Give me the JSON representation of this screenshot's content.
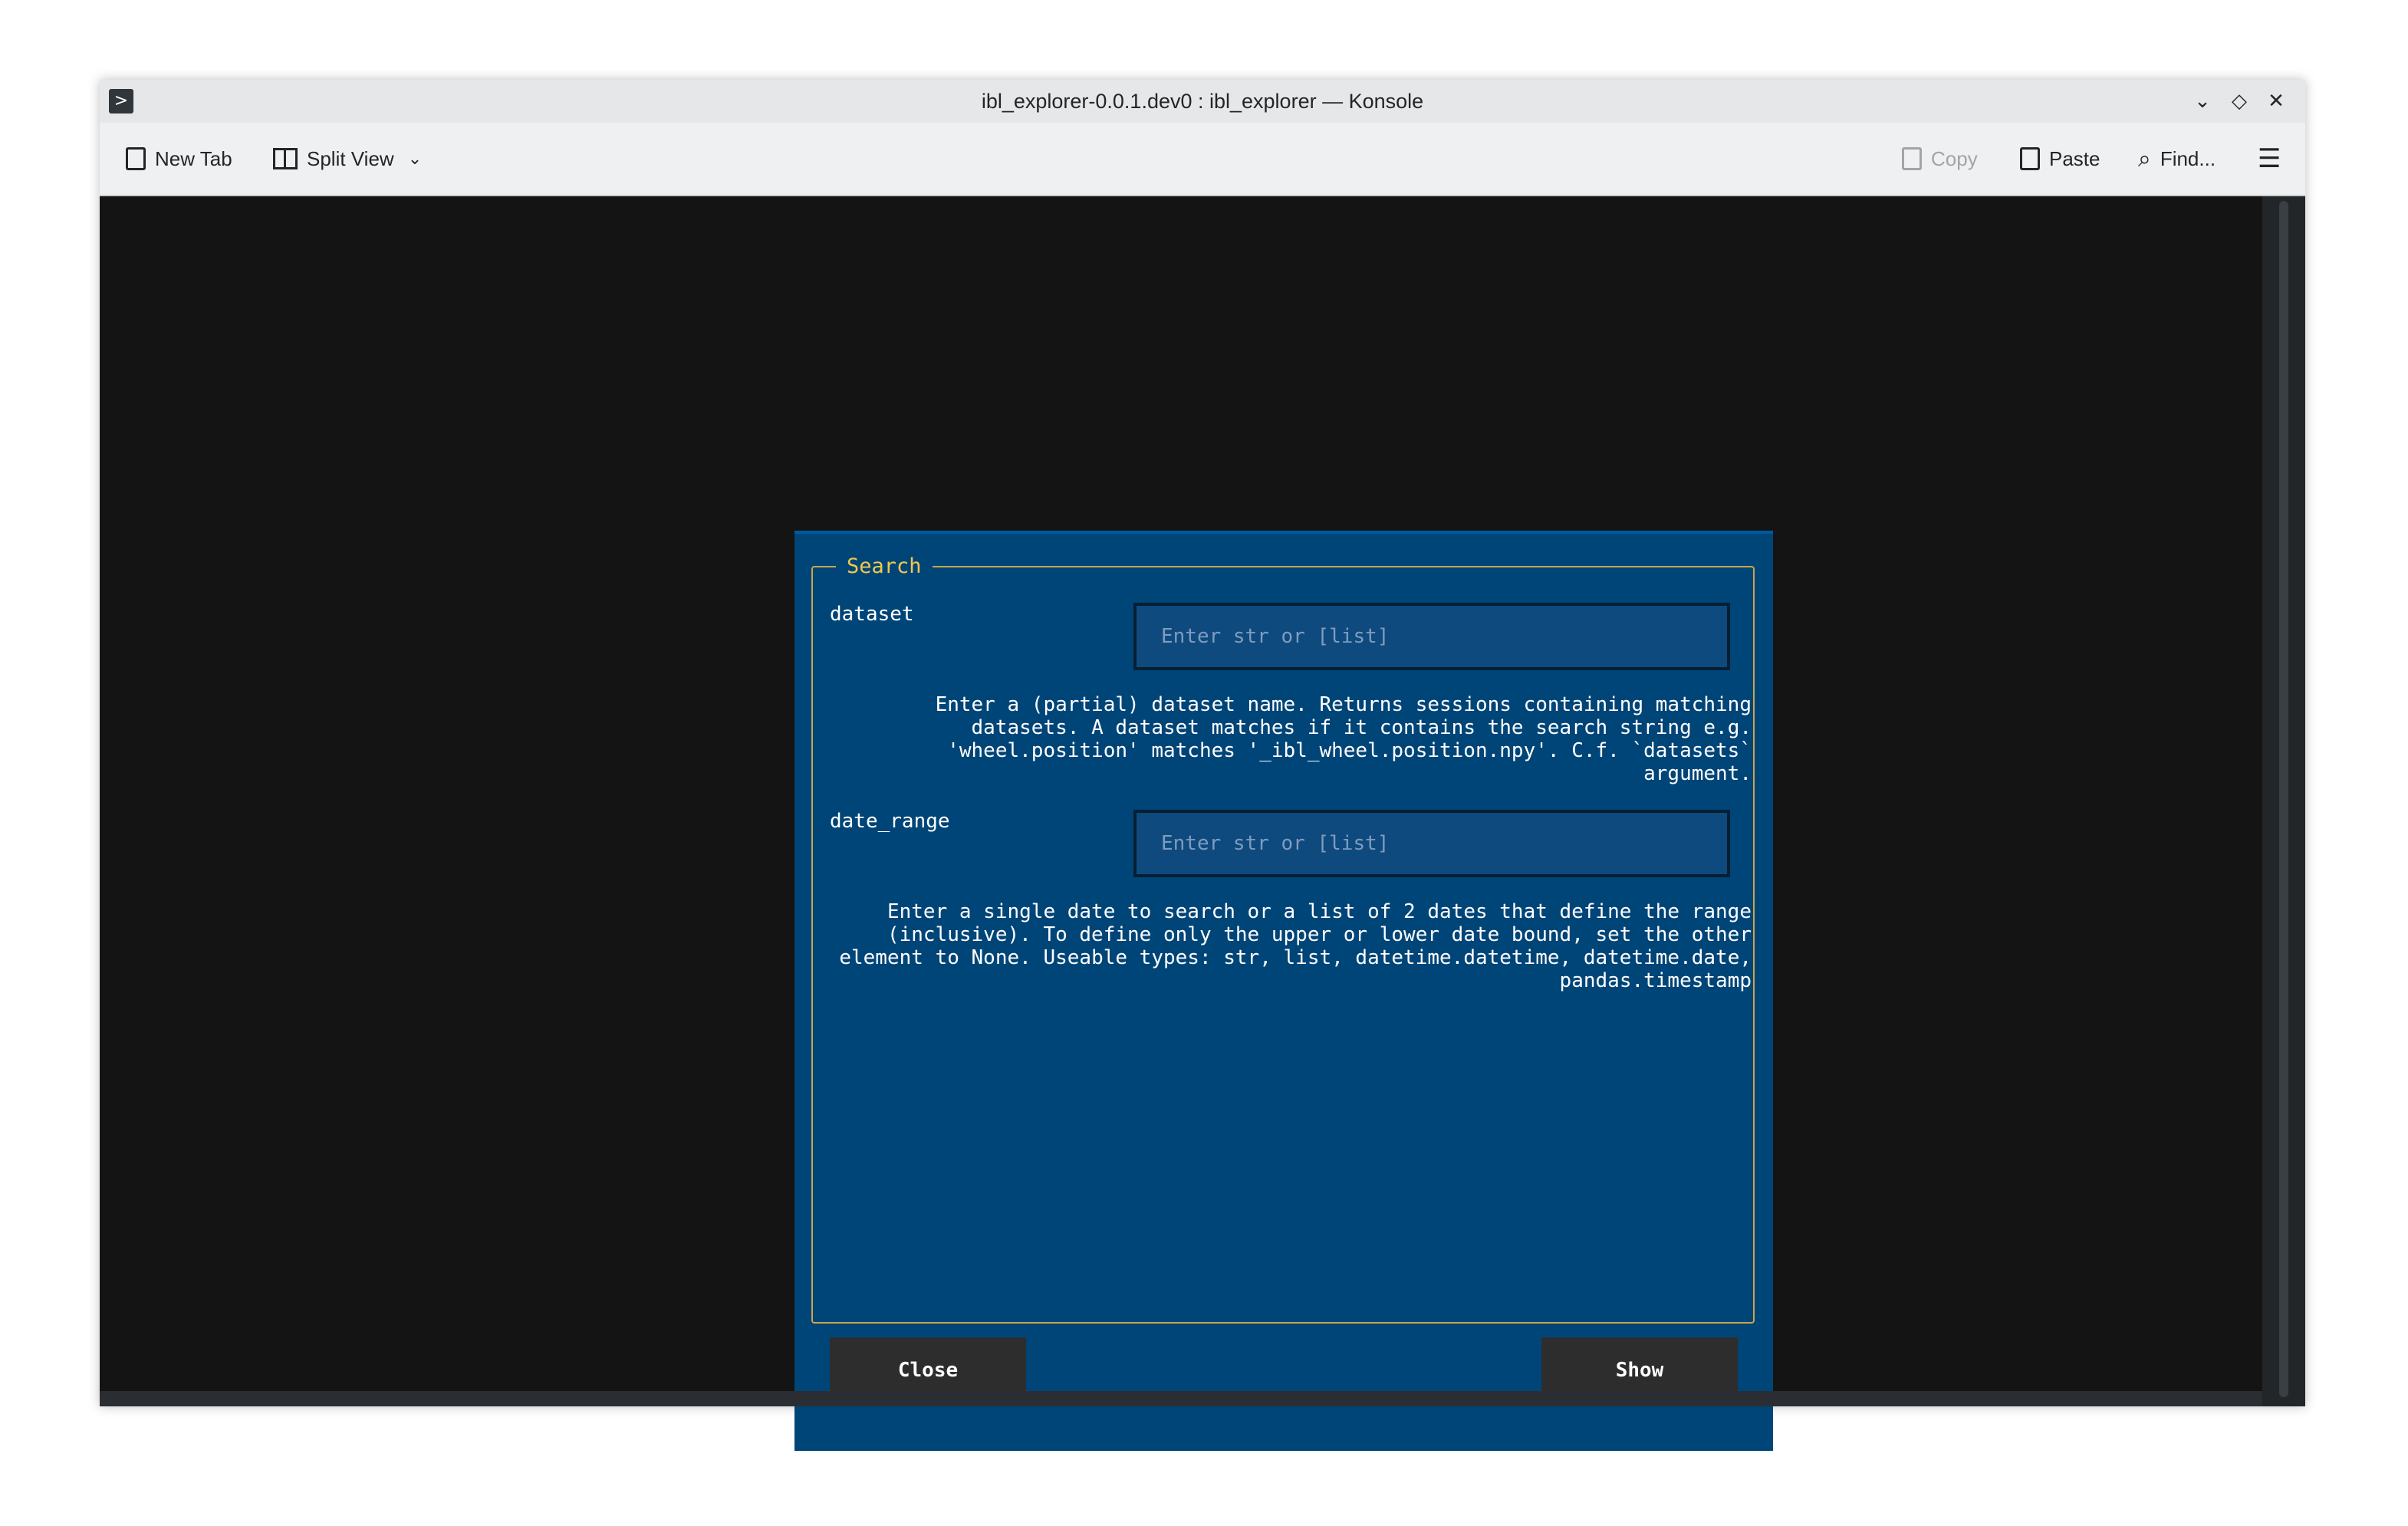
{
  "window": {
    "title": "ibl_explorer-0.0.1.dev0 : ibl_explorer — Konsole",
    "app_icon": ">",
    "controls": {
      "minimize": "⌄",
      "maximize": "◇",
      "close": "✕"
    }
  },
  "toolbar": {
    "new_tab": "New Tab",
    "split_view": "Split View",
    "copy": "Copy",
    "paste": "Paste",
    "find": "Find...",
    "menu_icon": "hamburger-menu-icon"
  },
  "dialog": {
    "legend": "Search",
    "fields": [
      {
        "label": "dataset",
        "placeholder": "Enter str or [list]",
        "help": "Enter a (partial) dataset name. Returns sessions containing matching\ndatasets. A dataset matches if it contains the search string e.g.\n'wheel.position' matches '_ibl_wheel.position.npy'. C.f. `datasets`\nargument."
      },
      {
        "label": "date_range",
        "placeholder": "Enter str or [list]",
        "help": "Enter a single date to search or a list of 2 dates that define the range\n(inclusive).  To define only the upper or lower date bound, set the other\nelement to None. Useable types: str, list, datetime.datetime, datetime.date,\npandas.timestamp"
      }
    ],
    "close_label": "Close",
    "show_label": "Show"
  },
  "colors": {
    "dialog_bg": "#004578",
    "legend_text": "#f2c94c",
    "frame_border": "#c8a64a",
    "terminal_bg": "#141414",
    "button_bg": "#2d2d2d"
  }
}
